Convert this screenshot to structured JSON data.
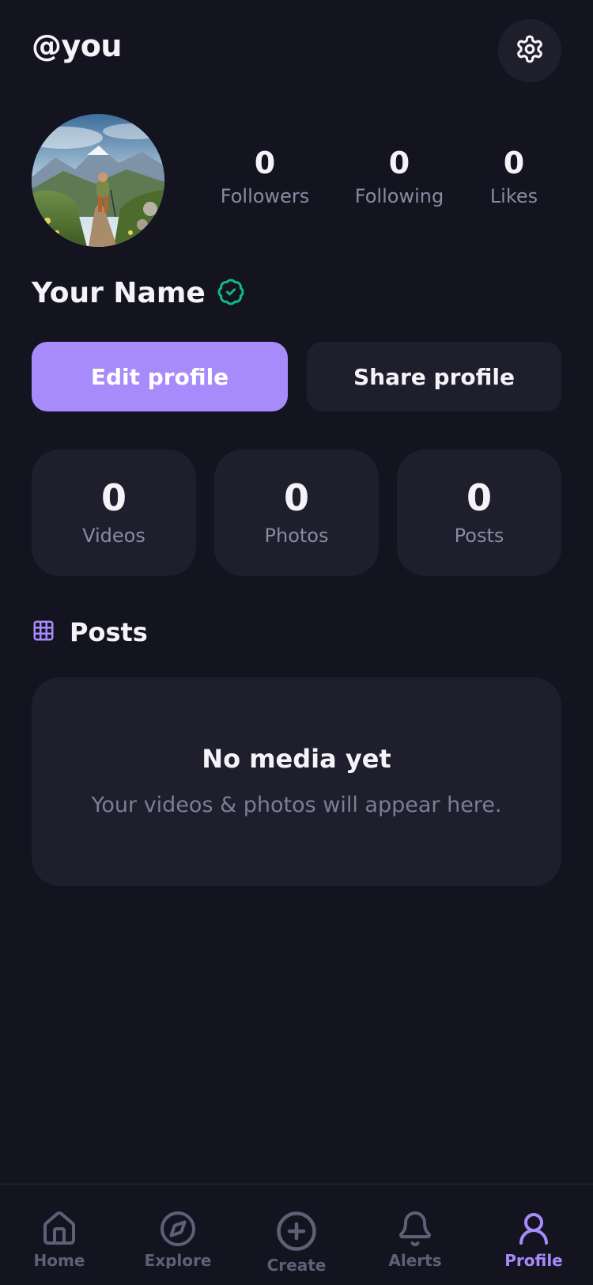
{
  "header": {
    "handle": "@you",
    "settings_icon": "gear-icon"
  },
  "profile": {
    "name": "Your Name",
    "verified_icon": "verified-badge-icon",
    "avatar": "hiker-on-mountain-trail",
    "stats": [
      {
        "value": "0",
        "label": "Followers"
      },
      {
        "value": "0",
        "label": "Following"
      },
      {
        "value": "0",
        "label": "Likes"
      }
    ]
  },
  "actions": {
    "edit_label": "Edit profile",
    "share_label": "Share profile"
  },
  "counts": [
    {
      "value": "0",
      "label": "Videos"
    },
    {
      "value": "0",
      "label": "Photos"
    },
    {
      "value": "0",
      "label": "Posts"
    }
  ],
  "posts": {
    "title": "Posts",
    "icon": "grid-icon",
    "empty_title": "No media yet",
    "empty_subtitle": "Your videos & photos will appear here."
  },
  "nav": {
    "items": [
      {
        "label": "Home",
        "icon": "home-icon",
        "active": false
      },
      {
        "label": "Explore",
        "icon": "compass-icon",
        "active": false
      },
      {
        "label": "Create",
        "icon": "plus-circle-icon",
        "active": false
      },
      {
        "label": "Alerts",
        "icon": "bell-icon",
        "active": false
      },
      {
        "label": "Profile",
        "icon": "user-icon",
        "active": true
      }
    ]
  },
  "colors": {
    "background": "#141421",
    "surface": "#1E1E2D",
    "accent": "#A78BFA",
    "verified": "#10B981",
    "muted_text": "#8A8AA2"
  }
}
